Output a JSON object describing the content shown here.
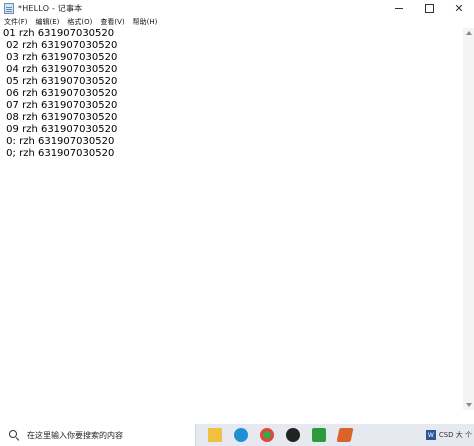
{
  "window": {
    "title": "*HELLO - 记事本",
    "controls": {
      "minimize_icon": "minimize-icon",
      "maximize_icon": "maximize-icon",
      "close_label": "✕"
    }
  },
  "menubar": {
    "items": [
      {
        "label": "文件(F)"
      },
      {
        "label": "编辑(E)"
      },
      {
        "label": "格式(O)"
      },
      {
        "label": "查看(V)"
      },
      {
        "label": "帮助(H)"
      }
    ]
  },
  "editor": {
    "lines": [
      "01 rzh 631907030520",
      " 02 rzh 631907030520",
      " 03 rzh 631907030520",
      " 04 rzh 631907030520",
      " 05 rzh 631907030520",
      " 06 rzh 631907030520",
      " 07 rzh 631907030520",
      " 08 rzh 631907030520",
      " 09 rzh 631907030520",
      " 0: rzh 631907030520",
      " 0; rzh 631907030520"
    ]
  },
  "taskbar": {
    "search_placeholder": "在这里输入你要搜索的内容",
    "pinned_icons": [
      "folder-icon",
      "edge-icon",
      "chrome-icon",
      "qq-icon",
      "wps-icon",
      "matlab-icon"
    ],
    "tray_text": "CSD 大 个"
  }
}
